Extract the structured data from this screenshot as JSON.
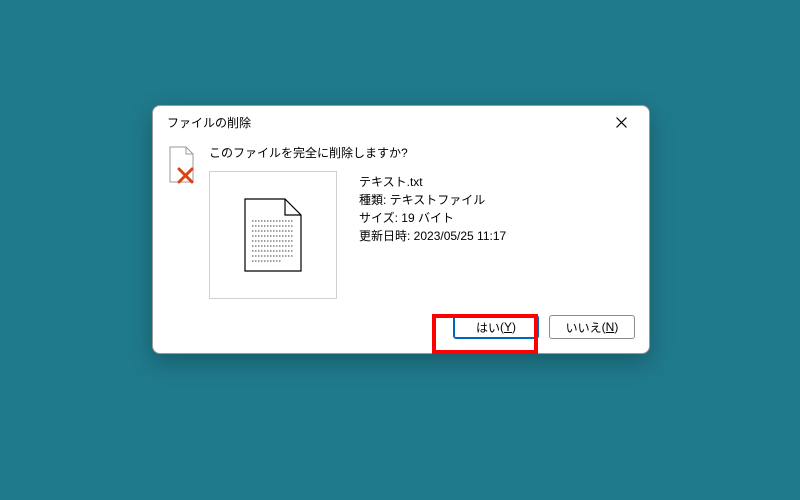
{
  "dialog": {
    "title": "ファイルの削除",
    "question": "このファイルを完全に削除しますか?",
    "file": {
      "name": "テキスト.txt",
      "type_label": "種類: テキストファイル",
      "size_label": "サイズ: 19 バイト",
      "modified_label": "更新日時: 2023/05/25 11:17"
    },
    "buttons": {
      "yes_prefix": "はい",
      "yes_mnemonic": "Y",
      "no_prefix": "いいえ",
      "no_mnemonic": "N"
    }
  }
}
